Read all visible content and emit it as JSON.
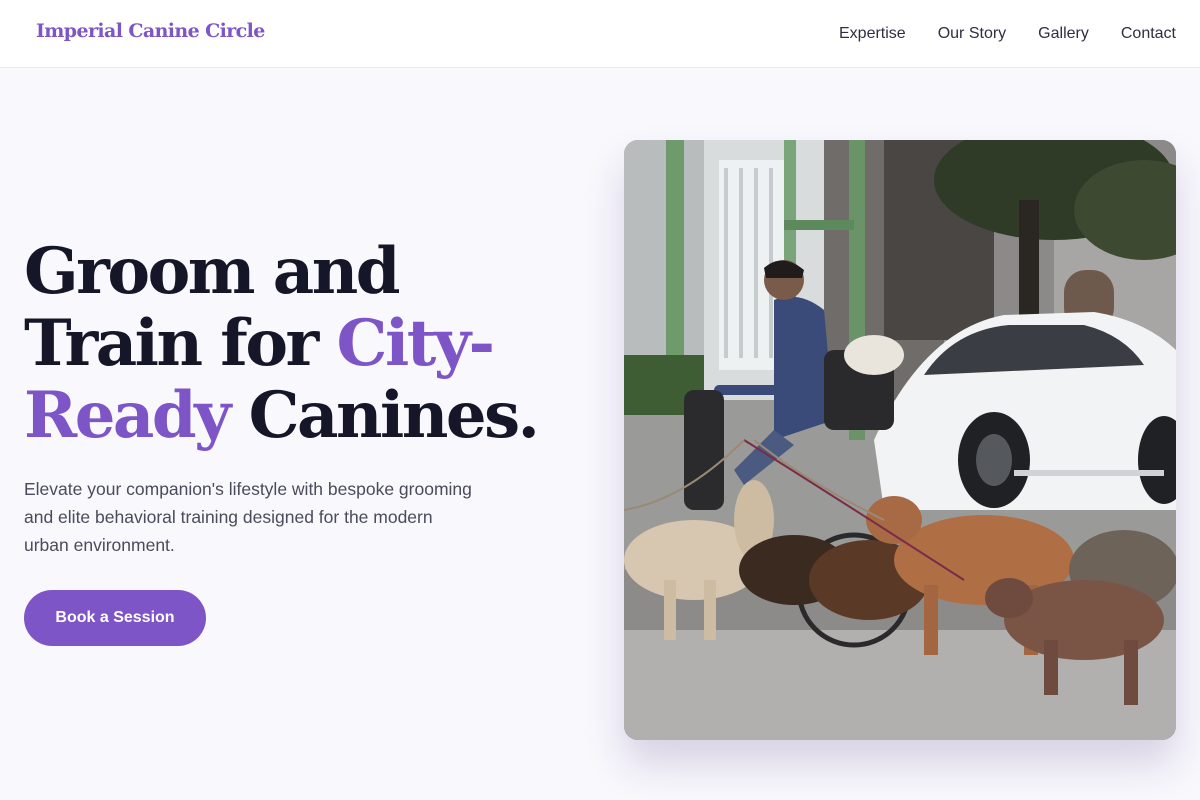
{
  "header": {
    "logo": "Imperial Canine Circle",
    "nav": [
      "Expertise",
      "Our Story",
      "Gallery",
      "Contact"
    ]
  },
  "hero": {
    "title_line1": "Groom and",
    "title_line2_prefix": "Train for ",
    "title_line2_accent": "City-",
    "title_line3_accent": "Ready",
    "title_line3_suffix": " Canines.",
    "subtitle": "Elevate your companion's lifestyle with bespoke grooming and elite behavioral training designed for the modern urban environment.",
    "cta_label": "Book a Session"
  },
  "photo": {
    "subject": "street photo: cyclist walking a pack of dogs past a white car"
  },
  "colors": {
    "accent": "#7d55c7",
    "heading": "#151728",
    "background": "#f9f8fd"
  }
}
